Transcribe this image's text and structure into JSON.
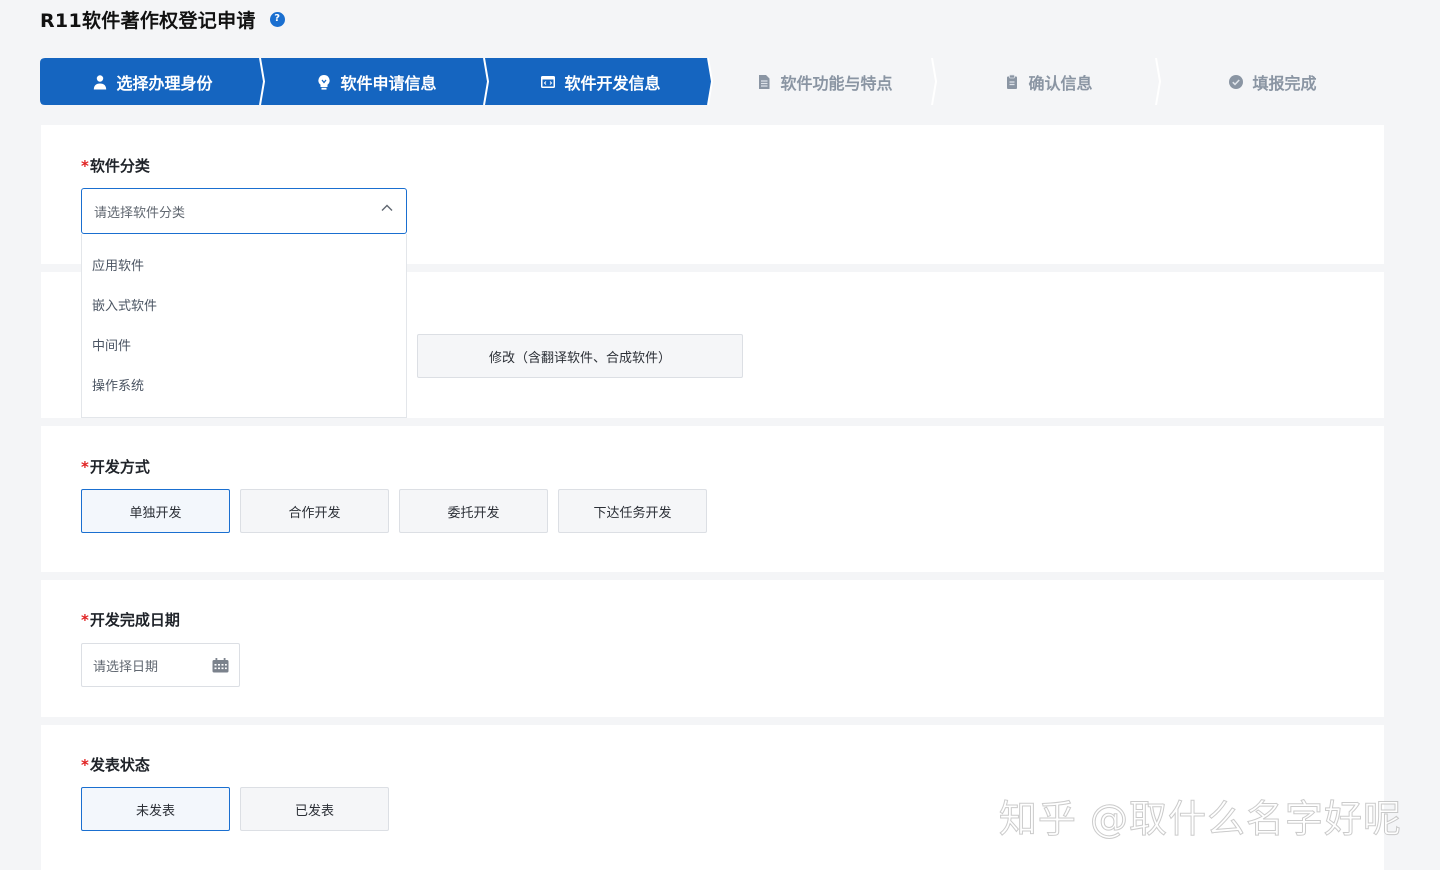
{
  "page": {
    "title": "R11软件著作权登记申请",
    "help_icon": "question-circle-icon"
  },
  "stepper": {
    "active_color": "#1565c0",
    "inactive_color": "#dfe4ea",
    "steps": [
      {
        "label": "选择办理身份",
        "icon": "user-icon",
        "active": true
      },
      {
        "label": "软件申请信息",
        "icon": "lightbulb-icon",
        "active": true
      },
      {
        "label": "软件开发信息",
        "icon": "code-window-icon",
        "active": true
      },
      {
        "label": "软件功能与特点",
        "icon": "document-icon",
        "active": false
      },
      {
        "label": "确认信息",
        "icon": "clipboard-icon",
        "active": false
      },
      {
        "label": "填报完成",
        "icon": "check-circle-icon",
        "active": false
      }
    ]
  },
  "category": {
    "required_mark": "*",
    "label": "软件分类",
    "placeholder": "请选择软件分类",
    "options": [
      "应用软件",
      "嵌入式软件",
      "中间件",
      "操作系统"
    ]
  },
  "nature": {
    "modify_option": "修改（含翻译软件、合成软件）"
  },
  "dev_method": {
    "required_mark": "*",
    "label": "开发方式",
    "options": [
      {
        "label": "单独开发",
        "selected": true
      },
      {
        "label": "合作开发",
        "selected": false
      },
      {
        "label": "委托开发",
        "selected": false
      },
      {
        "label": "下达任务开发",
        "selected": false
      }
    ]
  },
  "completion_date": {
    "required_mark": "*",
    "label": "开发完成日期",
    "placeholder": "请选择日期",
    "icon": "calendar-icon"
  },
  "publish_status": {
    "required_mark": "*",
    "label": "发表状态",
    "options": [
      {
        "label": "未发表",
        "selected": true
      },
      {
        "label": "已发表",
        "selected": false
      }
    ]
  },
  "watermark": "知乎 @取什么名字好呢"
}
